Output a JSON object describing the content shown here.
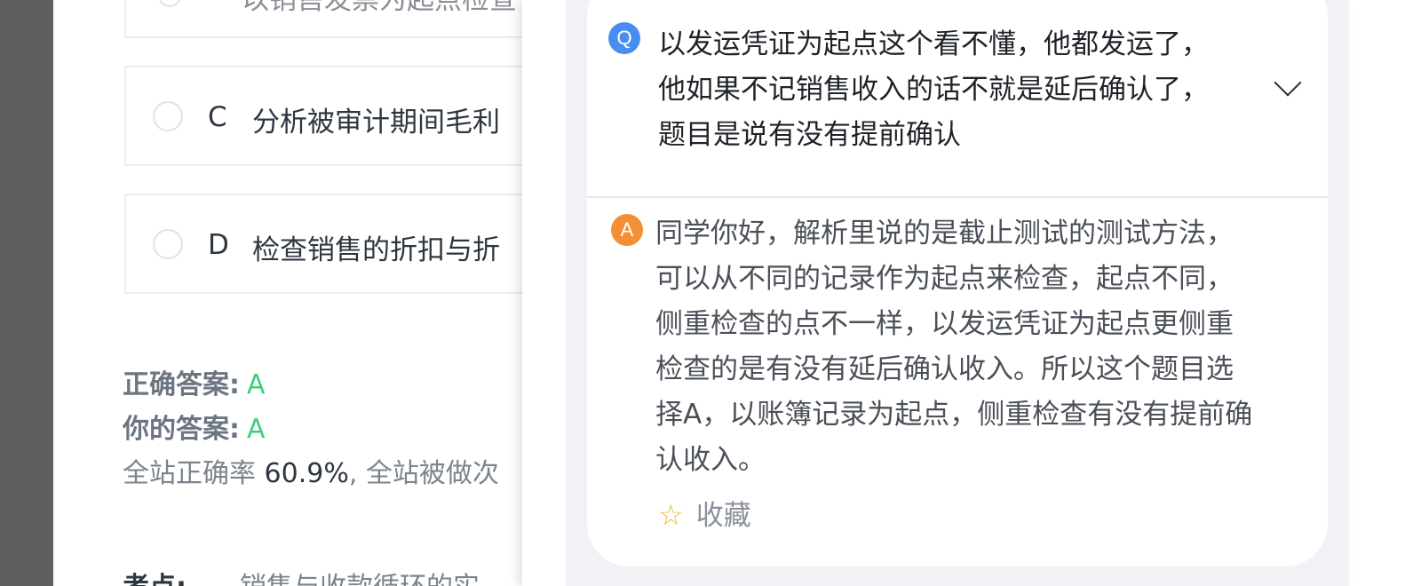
{
  "quiz": {
    "option_b": {
      "text": "以销售发票为起点检查"
    },
    "option_c": {
      "letter": "C",
      "text": "分析被审计期间毛利"
    },
    "option_d": {
      "letter": "D",
      "text": "检查销售的折扣与折"
    },
    "correct_answer": {
      "label": "正确答案:",
      "value": "A"
    },
    "your_answer": {
      "label": "你的答案:",
      "value": "A"
    },
    "stats": {
      "prefix": "全站正确率 ",
      "rate": "60.9%",
      "suffix": ", 全站被做次"
    },
    "kaodian": {
      "label": "考点:",
      "text": "销售与收款循环的实"
    }
  },
  "qa": {
    "question_badge": "Q",
    "question_lines": [
      "以发运凭证为起点这个看不懂，他都发运了，",
      "他如果不记销售收入的话不就是延后确认了，",
      "题目是说有没有提前确认"
    ],
    "answer_badge": "A",
    "answer_lines": [
      "同学你好，解析里说的是截止测试的测试方法，",
      "可以从不同的记录作为起点来检查，起点不同，",
      "侧重检查的点不一样，以发运凭证为起点更侧重",
      "检查的是有没有延后确认收入。所以这个题目选",
      "择A，以账簿记录为起点，侧重检查有没有提前确",
      "认收入。"
    ],
    "favorite_label": "收藏",
    "favorite_icon": "star-outline-icon"
  },
  "colors": {
    "accent_green": "#3ccf7c",
    "q_badge": "#4a8df0",
    "a_badge": "#f29033",
    "star": "#e5b93a"
  }
}
